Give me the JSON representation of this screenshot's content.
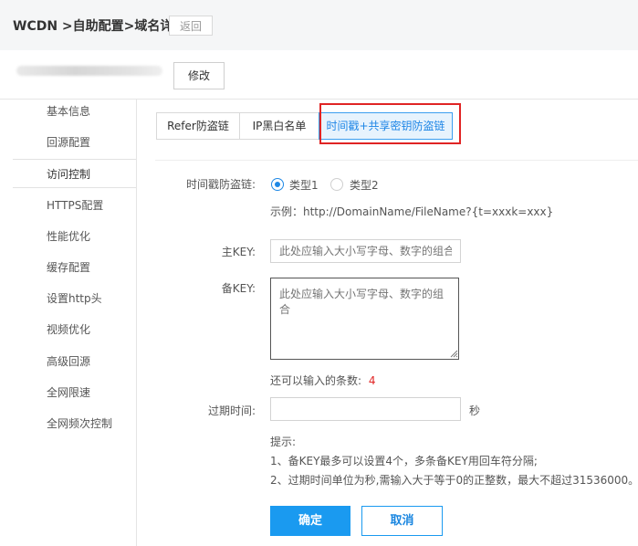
{
  "header": {
    "title": "WCDN >自助配置>域名详情",
    "back_label": "返回"
  },
  "domain_row": {
    "modify_label": "修改"
  },
  "sidebar": {
    "items": [
      {
        "label": "基本信息"
      },
      {
        "label": "回源配置"
      },
      {
        "label": "访问控制",
        "active": true
      },
      {
        "label": "HTTPS配置"
      },
      {
        "label": "性能优化"
      },
      {
        "label": "缓存配置"
      },
      {
        "label": "设置http头"
      },
      {
        "label": "视频优化"
      },
      {
        "label": "高级回源"
      },
      {
        "label": "全网限速"
      },
      {
        "label": "全网频次控制"
      }
    ]
  },
  "tabs": [
    {
      "label": "Refer防盗链"
    },
    {
      "label": "IP黑白名单"
    },
    {
      "label": "时间戳+共享密钥防盗链",
      "active": true
    }
  ],
  "form": {
    "timestamp_label": "时间戳防盗链:",
    "type1_label": "类型1",
    "type2_label": "类型2",
    "selected_type": "类型1",
    "example_text": "示例：http://DomainName/FileName?{t=xxxk=xxx}",
    "main_key_label": "主KEY:",
    "main_key_placeholder": "此处应输入大小写字母、数字的组合",
    "main_key_value": "",
    "backup_key_label": "备KEY:",
    "backup_key_placeholder": "此处应输入大小写字母、数字的组合",
    "backup_key_value": "",
    "remaining_label": "还可以输入的条数:",
    "remaining_count": "4",
    "expire_label": "过期时间:",
    "expire_value": "",
    "expire_unit": "秒",
    "hint_title": "提示:",
    "hint_1": "1、备KEY最多可以设置4个，多条备KEY用回车符分隔;",
    "hint_2": "2、过期时间单位为秒,需输入大于等于0的正整数，最大不超过31536000。"
  },
  "actions": {
    "confirm_label": "确定",
    "cancel_label": "取消"
  },
  "colors": {
    "accent": "#1a9af0",
    "highlight_box": "#e02424",
    "count_red": "#e02424"
  }
}
